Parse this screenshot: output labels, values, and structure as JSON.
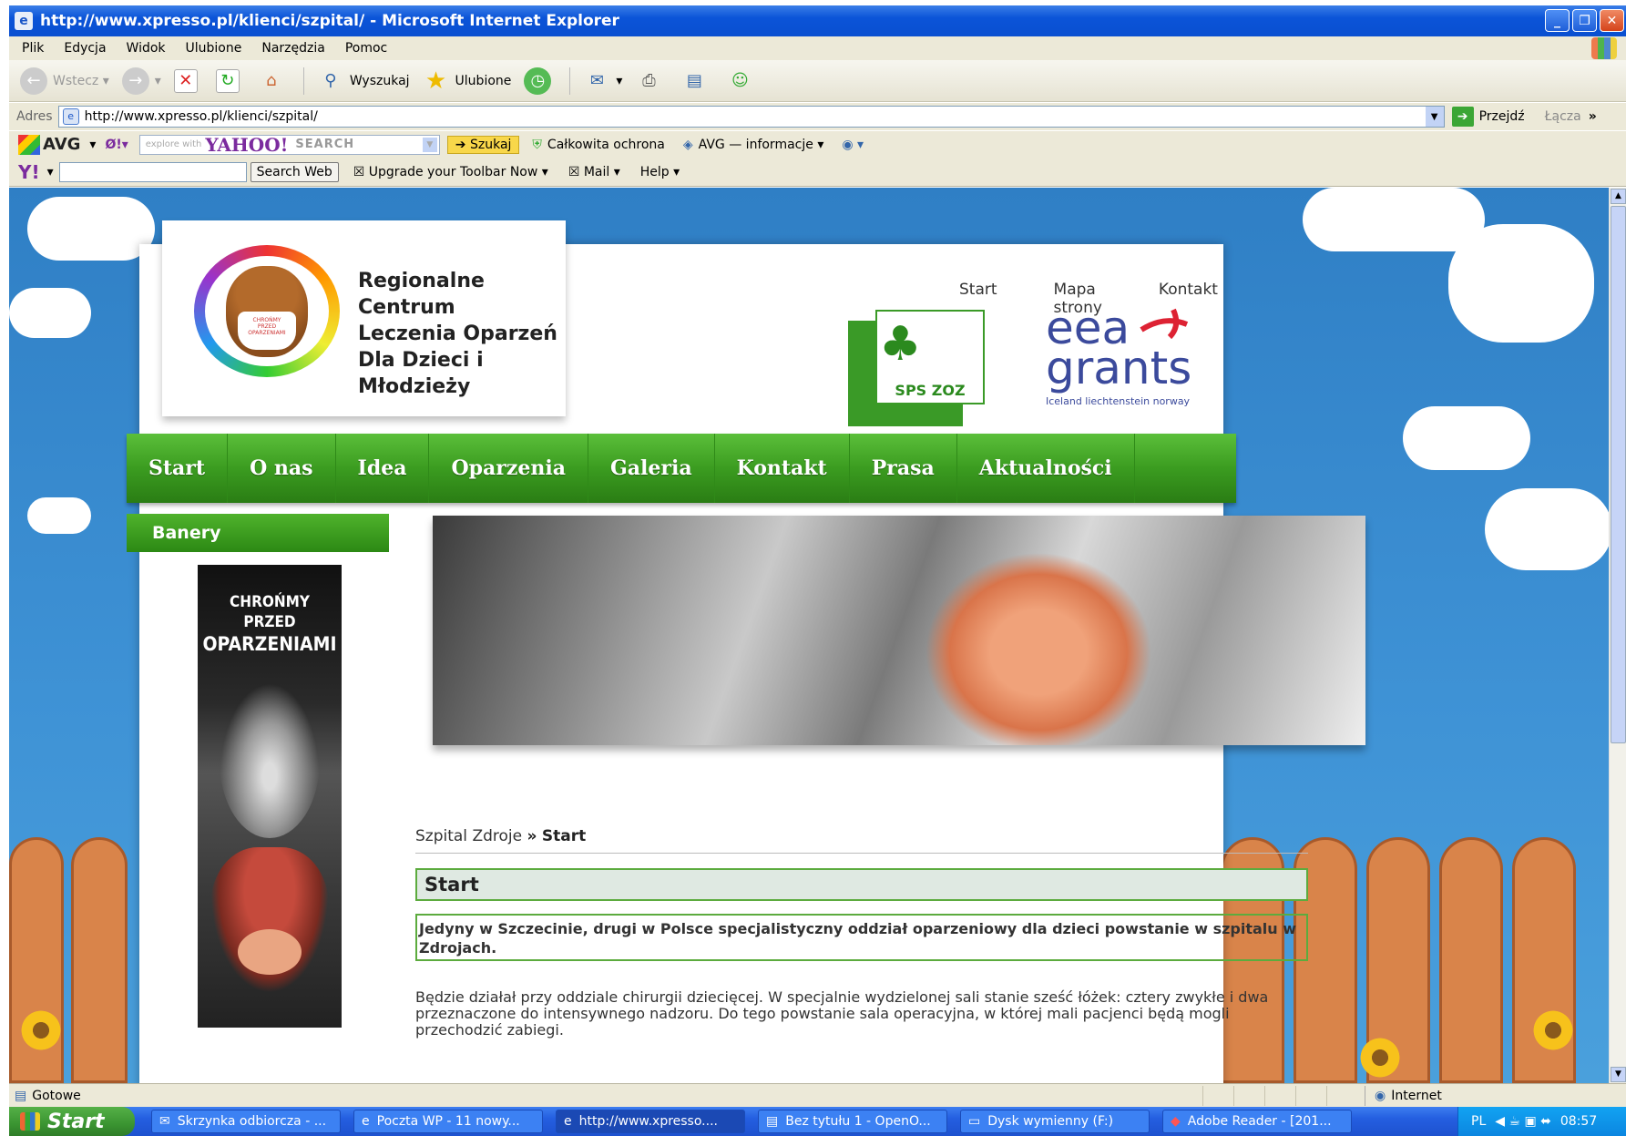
{
  "window": {
    "title": "http://www.xpresso.pl/klienci/szpital/ - Microsoft Internet Explorer"
  },
  "menu": [
    "Plik",
    "Edycja",
    "Widok",
    "Ulubione",
    "Narzędzia",
    "Pomoc"
  ],
  "toolbar": {
    "back": "Wstecz",
    "search": "Wyszukaj",
    "favorites": "Ulubione"
  },
  "address": {
    "label": "Adres",
    "url": "http://www.xpresso.pl/klienci/szpital/",
    "go": "Przejdź",
    "links": "Łącza"
  },
  "avgbar": {
    "logo": "AVG",
    "explore": "explore with",
    "yahoo": "YAHOO!",
    "search": "SEARCH",
    "szukaj": "Szukaj",
    "protection": "Całkowita ochrona",
    "info": "AVG — informacje"
  },
  "yahoobar": {
    "logo": "Y!",
    "search_btn": "Search Web",
    "upgrade": "Upgrade your Toolbar Now",
    "mail": "Mail",
    "help": "Help"
  },
  "site": {
    "org_name": [
      "Regionalne Centrum",
      "Leczenia Oparzeń",
      "Dla Dzieci i Młodzieży"
    ],
    "top_links": [
      "Start",
      "Mapa strony",
      "Kontakt"
    ],
    "sps_label": "SPS ZOZ",
    "eea": {
      "line1": "eea",
      "line2": "grants",
      "sub": "Iceland liechtenstein norway"
    },
    "nav": [
      "Start",
      "O nas",
      "Idea",
      "Oparzenia",
      "Galeria",
      "Kontakt",
      "Prasa",
      "Aktualności"
    ],
    "sidebar_title": "Banery",
    "banner": {
      "line1": "CHROŃMY",
      "line2": "PRZED",
      "line3": "OPARZENIAMI"
    },
    "breadcrumb": {
      "root": "Szpital Zdroje",
      "sep": "»",
      "current": "Start"
    },
    "heading": "Start",
    "lead": "Jedyny w Szczecinie, drugi w Polsce specjalistyczny oddział oparzeniowy dla dzieci powstanie w szpitalu w Zdrojach.",
    "body": "Będzie działał przy oddziale chirurgii dziecięcej. W specjalnie wydzielonej sali stanie sześć łóżek: cztery zwykłe i dwa przeznaczone do intensywnego nadzoru. Do tego powstanie sala operacyjna, w której mali pacjenci będą mogli przechodzić zabiegi."
  },
  "status": {
    "text": "Gotowe",
    "zone": "Internet"
  },
  "taskbar": {
    "start": "Start",
    "tasks": [
      "Skrzynka odbiorcza - ...",
      "Poczta WP - 11 nowy...",
      "http://www.xpresso....",
      "Bez tytułu 1 - OpenO...",
      "Dysk wymienny (F:)",
      "Adobe Reader - [201..."
    ],
    "lang": "PL",
    "clock": "08:57"
  }
}
